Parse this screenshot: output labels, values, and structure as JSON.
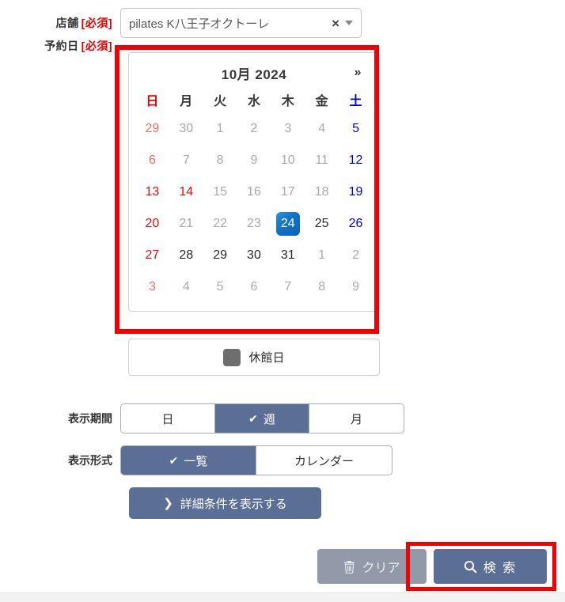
{
  "form": {
    "store": {
      "label": "店舗",
      "required_tag": "[必須]",
      "value": "pilates K八王子オクトーレ",
      "clear_icon": "×",
      "caret_icon": "chevron-down"
    },
    "date": {
      "label": "予約日",
      "required_tag": "[必須]"
    },
    "period": {
      "label": "表示期間",
      "options": [
        {
          "label": "日",
          "selected": false
        },
        {
          "label": "週",
          "selected": true
        },
        {
          "label": "月",
          "selected": false
        }
      ],
      "check_icon": "✔"
    },
    "format": {
      "label": "表示形式",
      "options": [
        {
          "label": "一覧",
          "selected": true
        },
        {
          "label": "カレンダー",
          "selected": false
        }
      ],
      "check_icon": "✔"
    },
    "detail_button": {
      "label": "詳細条件を表示する",
      "chevron": "❯"
    }
  },
  "calendar": {
    "title": "10月 2024",
    "next_label": "»",
    "prev_label": "«",
    "weekdays": [
      {
        "label": "日",
        "kind": "sun"
      },
      {
        "label": "月",
        "kind": "wd"
      },
      {
        "label": "火",
        "kind": "wd"
      },
      {
        "label": "水",
        "kind": "wd"
      },
      {
        "label": "木",
        "kind": "wd"
      },
      {
        "label": "金",
        "kind": "wd"
      },
      {
        "label": "土",
        "kind": "sat"
      }
    ],
    "weeks": [
      [
        {
          "day": "29",
          "state": "sun-off"
        },
        {
          "day": "30",
          "state": "off"
        },
        {
          "day": "1",
          "state": "off"
        },
        {
          "day": "2",
          "state": "off"
        },
        {
          "day": "3",
          "state": "off"
        },
        {
          "day": "4",
          "state": "off"
        },
        {
          "day": "5",
          "state": "sat"
        }
      ],
      [
        {
          "day": "6",
          "state": "sun-off"
        },
        {
          "day": "7",
          "state": "off"
        },
        {
          "day": "8",
          "state": "off"
        },
        {
          "day": "9",
          "state": "off"
        },
        {
          "day": "10",
          "state": "off"
        },
        {
          "day": "11",
          "state": "off"
        },
        {
          "day": "12",
          "state": "sat"
        }
      ],
      [
        {
          "day": "13",
          "state": "sun"
        },
        {
          "day": "14",
          "state": "sun"
        },
        {
          "day": "15",
          "state": "off"
        },
        {
          "day": "16",
          "state": "off"
        },
        {
          "day": "17",
          "state": "off"
        },
        {
          "day": "18",
          "state": "off"
        },
        {
          "day": "19",
          "state": "sat"
        }
      ],
      [
        {
          "day": "20",
          "state": "sun"
        },
        {
          "day": "21",
          "state": "off"
        },
        {
          "day": "22",
          "state": "off"
        },
        {
          "day": "23",
          "state": "off"
        },
        {
          "day": "24",
          "state": "selected"
        },
        {
          "day": "25",
          "state": "on"
        },
        {
          "day": "26",
          "state": "sat"
        }
      ],
      [
        {
          "day": "27",
          "state": "sun"
        },
        {
          "day": "28",
          "state": "on"
        },
        {
          "day": "29",
          "state": "on"
        },
        {
          "day": "30",
          "state": "on"
        },
        {
          "day": "31",
          "state": "on"
        },
        {
          "day": "1",
          "state": "off"
        },
        {
          "day": "2",
          "state": "off"
        }
      ],
      [
        {
          "day": "3",
          "state": "sun-off"
        },
        {
          "day": "4",
          "state": "off"
        },
        {
          "day": "5",
          "state": "off"
        },
        {
          "day": "6",
          "state": "off"
        },
        {
          "day": "7",
          "state": "off"
        },
        {
          "day": "8",
          "state": "off"
        },
        {
          "day": "9",
          "state": "off"
        }
      ]
    ],
    "legend": {
      "swatch_color": "#6e6e6e",
      "text": "休館日"
    },
    "selected_day": "24",
    "selected_color": "#1173c4"
  },
  "actions": {
    "clear": {
      "label": "クリア",
      "icon": "trash-icon",
      "disabled": true
    },
    "search": {
      "label": "検 索",
      "icon": "search-icon",
      "disabled": false
    }
  },
  "annotations": {
    "color": "#f50000",
    "boxes": [
      "calendar-region",
      "search-button-region"
    ]
  }
}
